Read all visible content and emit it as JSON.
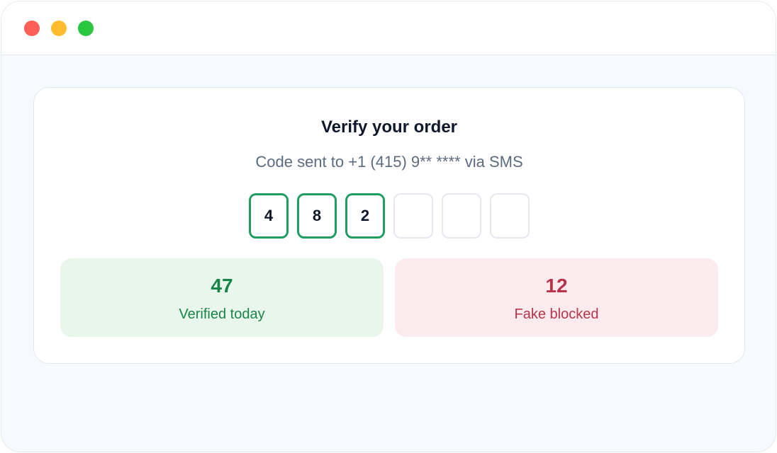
{
  "window": {
    "controls": [
      "close",
      "minimize",
      "maximize"
    ]
  },
  "verify": {
    "title": "Verify your order",
    "subtitle": "Code sent to +1 (415) 9** **** via SMS",
    "code_digits": [
      "4",
      "8",
      "2",
      "",
      "",
      ""
    ]
  },
  "stats": {
    "verified": {
      "value": "47",
      "label": "Verified today"
    },
    "blocked": {
      "value": "12",
      "label": "Fake blocked"
    }
  },
  "colors": {
    "accent_green": "#1f9d63",
    "verified_bg": "#e8f6ec",
    "verified_text": "#198448",
    "blocked_bg": "#fcebee",
    "blocked_text": "#b8344a",
    "window_close": "#ff5f57",
    "window_minimize": "#febc2e",
    "window_maximize": "#28c840"
  }
}
